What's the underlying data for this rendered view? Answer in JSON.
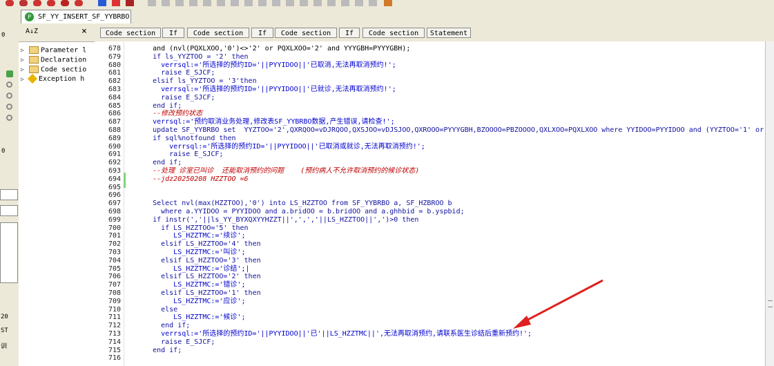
{
  "tab": {
    "title": "SF_YY_INSERT_SF_YYBRBO",
    "icon": "package-icon",
    "icon_letter": "P"
  },
  "left_strip": {
    "labels": [
      "0",
      "0",
      "20",
      "ST",
      "训"
    ]
  },
  "navigator": {
    "sort_icon": "A↓Z",
    "close": "×",
    "items": [
      "Parameter l",
      "Declaration",
      "Code sectio",
      "Exception h"
    ]
  },
  "segments": [
    "Code section",
    "If",
    "Code section",
    "If",
    "Code section",
    "If",
    "Code section",
    "Statement"
  ],
  "colors": {
    "keyword": "#1010a0",
    "string": "#0000d0",
    "comment": "#c00000",
    "arrow": "#e02020"
  },
  "code": [
    {
      "n": "678",
      "t": "    and (nvl(PQXLXOO,'0')<>'2' or PQXLXOO='2' and YYYGBH=PYYYGBH);",
      "k": "plain"
    },
    {
      "n": "679",
      "t": "    if ls_YYZTOO = '2' then",
      "k": "kw"
    },
    {
      "n": "680",
      "t": "      verrsql:='所选择的预约ID='||PYYIDOO||'已取消,无法再取消预约!';",
      "k": "str"
    },
    {
      "n": "681",
      "t": "      raise E_SJCF;",
      "k": "kw"
    },
    {
      "n": "682",
      "t": "    elsif ls_YYZTOO = '3'then",
      "k": "kw"
    },
    {
      "n": "683",
      "t": "      verrsql:='所选择的预约ID='||PYYIDOO||'已就诊,无法再取消预约!';",
      "k": "str"
    },
    {
      "n": "684",
      "t": "      raise E_SJCF;",
      "k": "kw"
    },
    {
      "n": "685",
      "t": "    end if;",
      "k": "kw"
    },
    {
      "n": "686",
      "t": "    --修改预约状态",
      "k": "cm"
    },
    {
      "n": "687",
      "t": "    verrsql:='预约取消业务处理,修改表SF_YYBRBO数据,产生错误,请检查!';",
      "k": "str"
    },
    {
      "n": "688",
      "t": "    update SF_YYBRBO set  YYZTOO='2',QXRQOO=vDJRQOO,QXSJOO=vDJSJOO,QXROOO=PYYYGBH,BZOOOO=PBZOOOO,QXLXOO=PQXLXOO where YYIDOO=PYYIDOO and (YYZTOO='1' or YYZTOO='C",
      "k": "kw"
    },
    {
      "n": "689",
      "t": "    if sql%notfound then",
      "k": "kw"
    },
    {
      "n": "690",
      "t": "        verrsql:='所选择的预约ID='||PYYIDOO||'已取消或就诊,无法再取消预约!';",
      "k": "str"
    },
    {
      "n": "691",
      "t": "        raise E_SJCF;",
      "k": "kw"
    },
    {
      "n": "692",
      "t": "    end if;",
      "k": "kw"
    },
    {
      "n": "693",
      "t": "    --处理 诊室已叫诊  还能取消预约的问题    (预约病人不允许取消预约的候诊状态)",
      "k": "cm"
    },
    {
      "n": "694",
      "t": "    --jdz20250208 HZZTOO =6",
      "k": "cm"
    },
    {
      "n": "695",
      "t": "",
      "k": "plain"
    },
    {
      "n": "696",
      "t": "",
      "k": "plain"
    },
    {
      "n": "697",
      "t": "    Select nvl(max(HZZTOO),'0') into LS_HZZTOO from SF_YYBRBO a, SF_HZBROO b",
      "k": "kw"
    },
    {
      "n": "698",
      "t": "      where a.YYIDOO = PYYIDOO and a.bridOO = b.bridOO and a.ghhbid = b.yspbid;",
      "k": "kw"
    },
    {
      "n": "699",
      "t": "    if instr(','||ls_YY_BYXQXYYHZZT||',',','||LS_HZZTOO||',')>0 then",
      "k": "kw"
    },
    {
      "n": "700",
      "t": "      if LS_HZZTOO='5' then",
      "k": "kw"
    },
    {
      "n": "701",
      "t": "         LS_HZZTMC:='续诊';",
      "k": "str"
    },
    {
      "n": "702",
      "t": "      elsif LS_HZZTOO='4' then",
      "k": "kw"
    },
    {
      "n": "703",
      "t": "         LS_HZZTMC:='叫诊';",
      "k": "str"
    },
    {
      "n": "704",
      "t": "      elsif LS_HZZTOO='3' then",
      "k": "kw"
    },
    {
      "n": "705",
      "t": "         LS_HZZTMC:='诊结';|",
      "k": "str"
    },
    {
      "n": "706",
      "t": "      elsif LS_HZZTOO='2' then",
      "k": "kw"
    },
    {
      "n": "707",
      "t": "         LS_HZZTMC:='错诊';",
      "k": "str"
    },
    {
      "n": "708",
      "t": "      elsif LS_HZZTOO='1' then",
      "k": "kw"
    },
    {
      "n": "709",
      "t": "         LS_HZZTMC:='应诊';",
      "k": "str"
    },
    {
      "n": "710",
      "t": "      else",
      "k": "kw"
    },
    {
      "n": "711",
      "t": "         LS_HZZTMC:='候诊';",
      "k": "str"
    },
    {
      "n": "712",
      "t": "      end if;",
      "k": "kw"
    },
    {
      "n": "713",
      "t": "      verrsql:='所选择的预约ID='||PYYIDOO||'已'||LS_HZZTMC||',无法再取消预约,请联系医生诊结后重新预约!';",
      "k": "str"
    },
    {
      "n": "714",
      "t": "      raise E_SJCF;",
      "k": "kw"
    },
    {
      "n": "715",
      "t": "    end if;",
      "k": "kw"
    },
    {
      "n": "716",
      "t": "",
      "k": "plain"
    }
  ]
}
